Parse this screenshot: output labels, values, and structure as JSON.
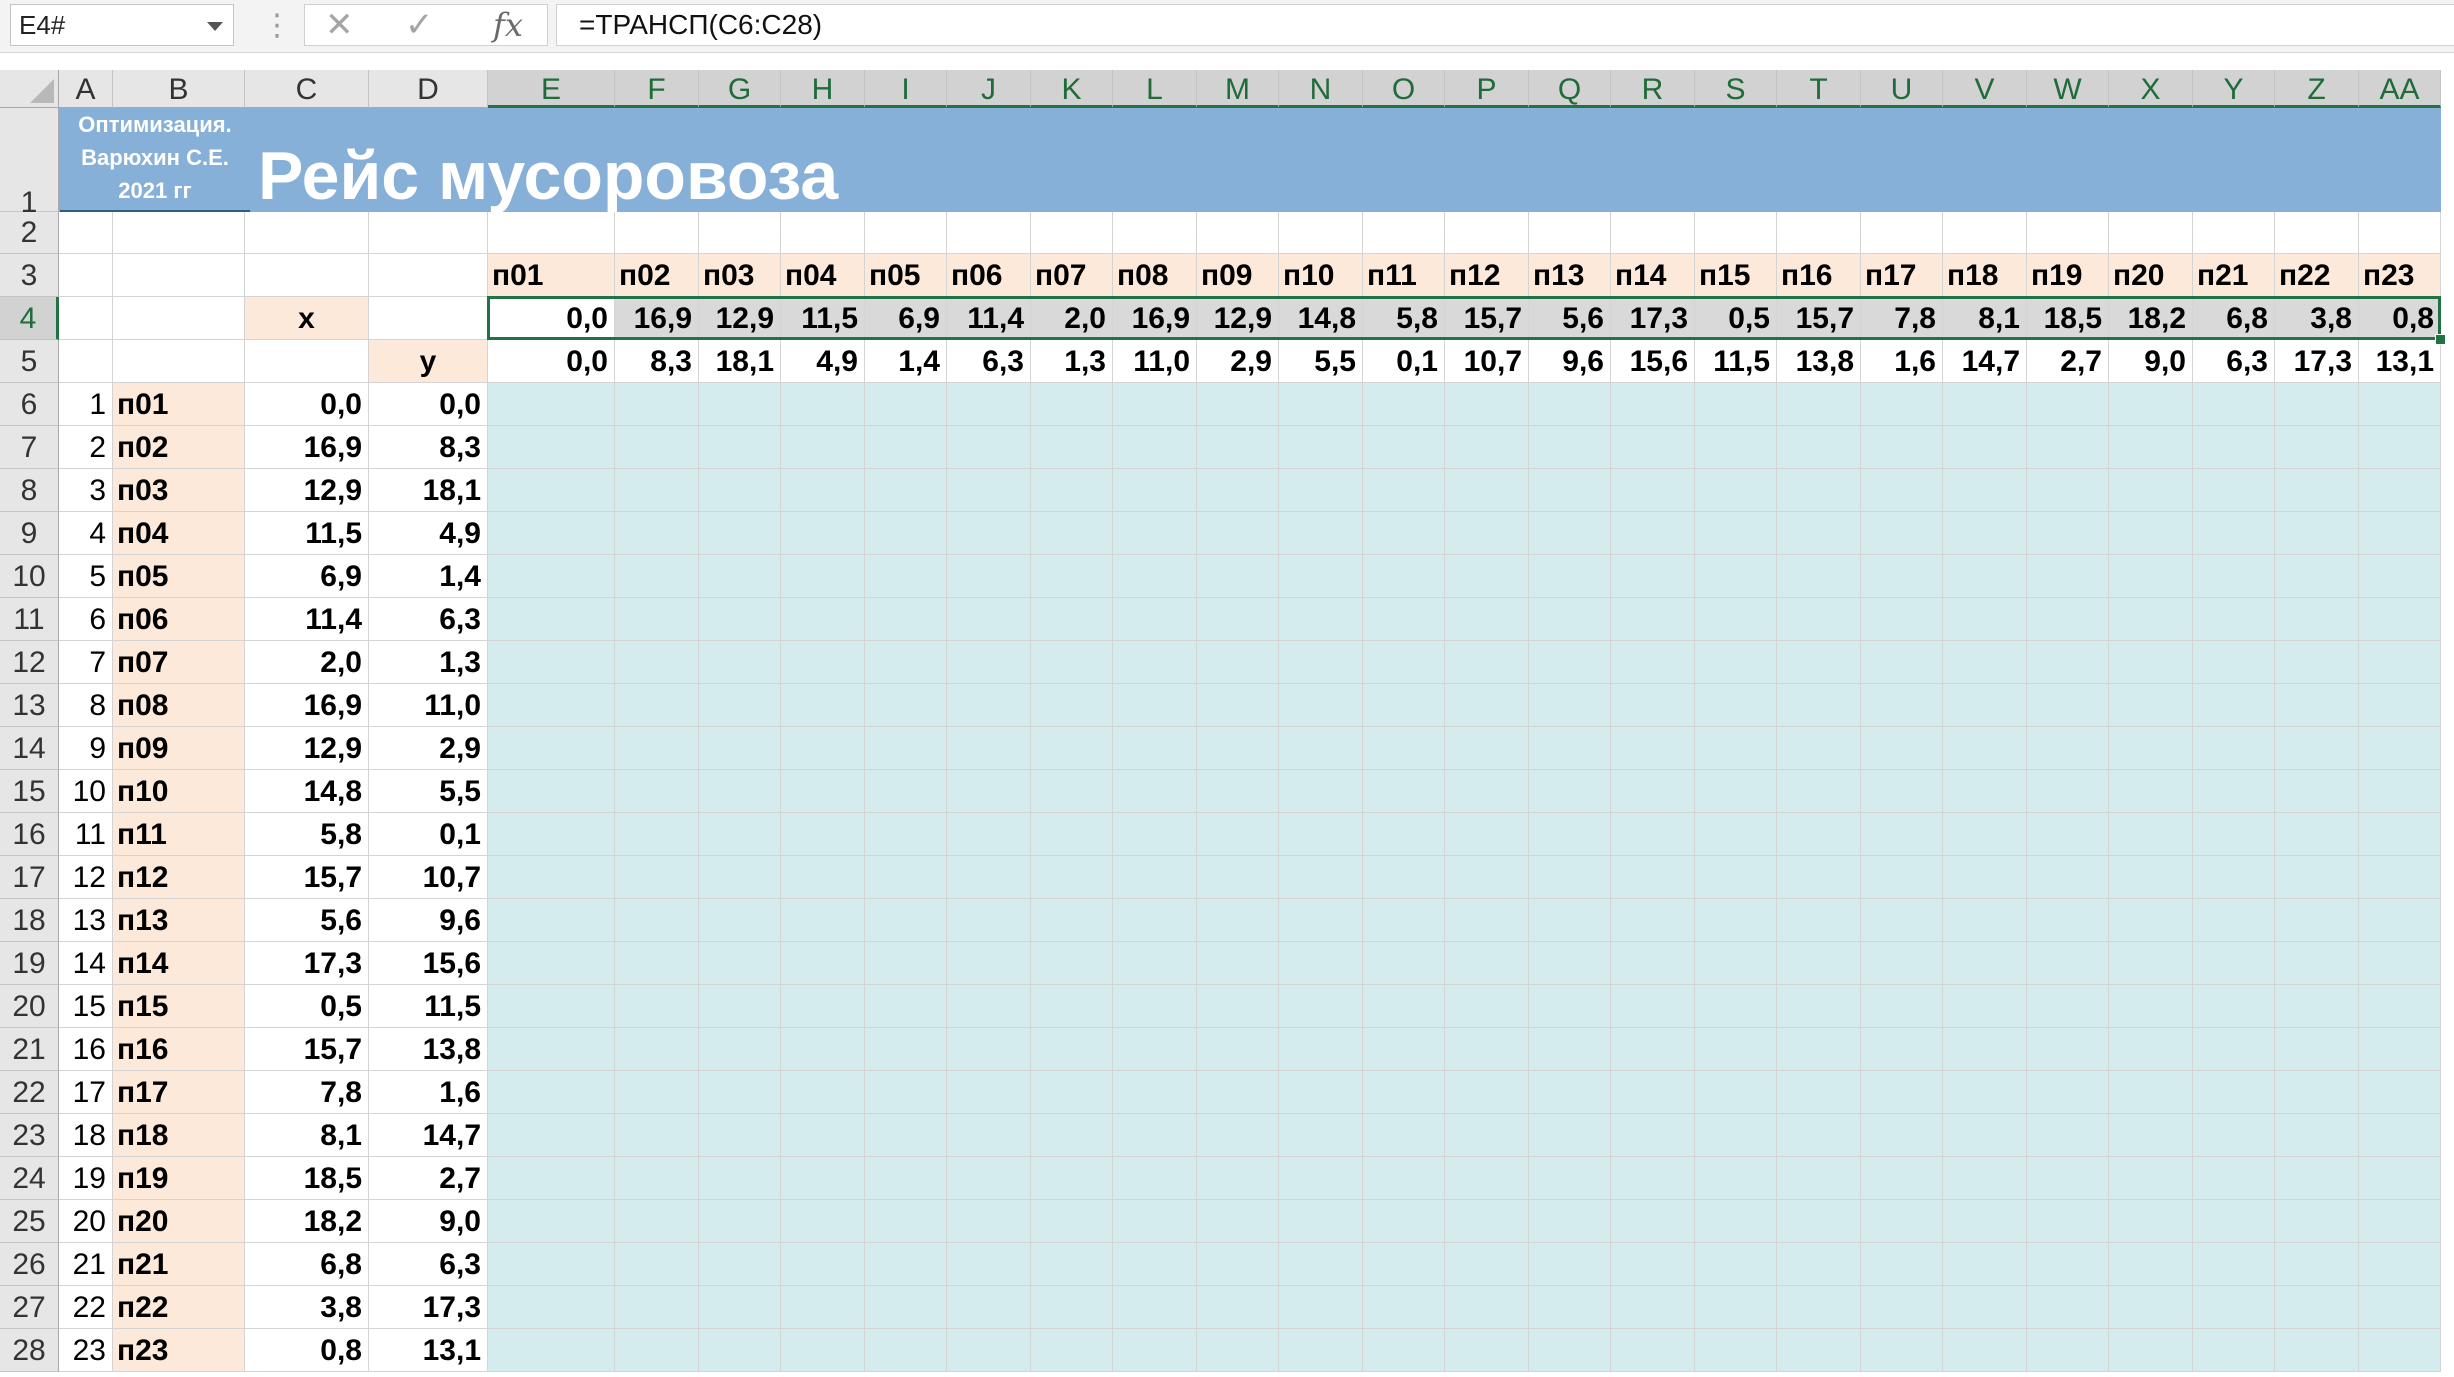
{
  "formula_bar": {
    "name_box": "E4#",
    "cancel_icon": "✕",
    "enter_icon": "✓",
    "fx_icon": "fx",
    "formula": "=ТРАНСП(C6:C28)"
  },
  "sheet": {
    "title": "Рейс мусоровоза",
    "author_line1": "Оптимизация.",
    "author_line2": "Варюхин С.Е.",
    "author_line3": "2021 гг",
    "header_x": "x",
    "header_y": "y",
    "selected_cell": "E4",
    "columns": [
      "A",
      "B",
      "C",
      "D",
      "E",
      "F",
      "G",
      "H",
      "I",
      "J",
      "K",
      "L",
      "M",
      "N",
      "O",
      "P",
      "Q",
      "R",
      "S",
      "T",
      "U",
      "V",
      "W",
      "X",
      "Y",
      "Z",
      "AA"
    ],
    "rows": [
      "1",
      "2",
      "3",
      "4",
      "5",
      "6",
      "7",
      "8",
      "9",
      "10",
      "11",
      "12",
      "13",
      "14",
      "15",
      "16",
      "17",
      "18",
      "19",
      "20",
      "21",
      "22",
      "23",
      "24",
      "25",
      "26",
      "27",
      "28"
    ],
    "points": [
      {
        "n": "1",
        "name": "п01",
        "x": "0,0",
        "y": "0,0"
      },
      {
        "n": "2",
        "name": "п02",
        "x": "16,9",
        "y": "8,3"
      },
      {
        "n": "3",
        "name": "п03",
        "x": "12,9",
        "y": "18,1"
      },
      {
        "n": "4",
        "name": "п04",
        "x": "11,5",
        "y": "4,9"
      },
      {
        "n": "5",
        "name": "п05",
        "x": "6,9",
        "y": "1,4"
      },
      {
        "n": "6",
        "name": "п06",
        "x": "11,4",
        "y": "6,3"
      },
      {
        "n": "7",
        "name": "п07",
        "x": "2,0",
        "y": "1,3"
      },
      {
        "n": "8",
        "name": "п08",
        "x": "16,9",
        "y": "11,0"
      },
      {
        "n": "9",
        "name": "п09",
        "x": "12,9",
        "y": "2,9"
      },
      {
        "n": "10",
        "name": "п10",
        "x": "14,8",
        "y": "5,5"
      },
      {
        "n": "11",
        "name": "п11",
        "x": "5,8",
        "y": "0,1"
      },
      {
        "n": "12",
        "name": "п12",
        "x": "15,7",
        "y": "10,7"
      },
      {
        "n": "13",
        "name": "п13",
        "x": "5,6",
        "y": "9,6"
      },
      {
        "n": "14",
        "name": "п14",
        "x": "17,3",
        "y": "15,6"
      },
      {
        "n": "15",
        "name": "п15",
        "x": "0,5",
        "y": "11,5"
      },
      {
        "n": "16",
        "name": "п16",
        "x": "15,7",
        "y": "13,8"
      },
      {
        "n": "17",
        "name": "п17",
        "x": "7,8",
        "y": "1,6"
      },
      {
        "n": "18",
        "name": "п18",
        "x": "8,1",
        "y": "14,7"
      },
      {
        "n": "19",
        "name": "п19",
        "x": "18,5",
        "y": "2,7"
      },
      {
        "n": "20",
        "name": "п20",
        "x": "18,2",
        "y": "9,0"
      },
      {
        "n": "21",
        "name": "п21",
        "x": "6,8",
        "y": "6,3"
      },
      {
        "n": "22",
        "name": "п22",
        "x": "3,8",
        "y": "17,3"
      },
      {
        "n": "23",
        "name": "п23",
        "x": "0,8",
        "y": "13,1"
      }
    ]
  },
  "colors": {
    "title_band": "#86b0d8",
    "peach": "#fde9d9",
    "light_blue": "#d5ecef",
    "selection_green": "#217346"
  }
}
